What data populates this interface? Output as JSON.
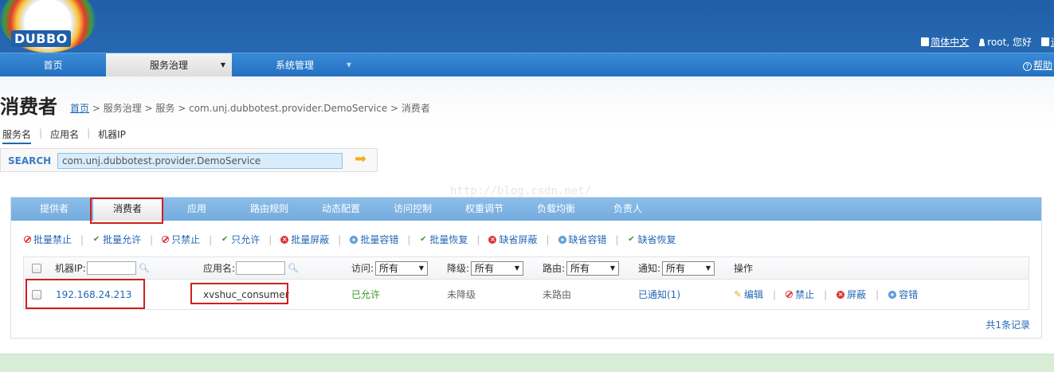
{
  "header": {
    "logo_text": "DUBBO",
    "language_label": "简体中文",
    "user_greeting": "root, 您好",
    "logout_label": "退出"
  },
  "nav": {
    "items": [
      {
        "label": "首页"
      },
      {
        "label": "服务治理"
      },
      {
        "label": "系统管理"
      }
    ],
    "help_label": "帮助"
  },
  "page": {
    "title": "消费者",
    "breadcrumb_home": "首页",
    "breadcrumb_rest": " > 服务治理 > 服务 > com.unj.dubbotest.provider.DemoService > 消费者"
  },
  "search": {
    "tabs": [
      "服务名",
      "应用名",
      "机器IP"
    ],
    "label": "SEARCH",
    "value": "com.unj.dubbotest.provider.DemoService"
  },
  "watermark": "http://blog.csdn.net/",
  "subtabs": [
    "提供者",
    "消费者",
    "应用",
    "路由规则",
    "动态配置",
    "访问控制",
    "权重调节",
    "负载均衡",
    "负责人"
  ],
  "actions": [
    "批量禁止",
    "批量允许",
    "只禁止",
    "只允许",
    "批量屏蔽",
    "批量容错",
    "批量恢复",
    "缺省屏蔽",
    "缺省容错",
    "缺省恢复"
  ],
  "table": {
    "headers": {
      "ip": "机器IP:",
      "app": "应用名:",
      "access": "访问:",
      "degrade": "降级:",
      "route": "路由:",
      "notify": "通知:",
      "ops": "操作"
    },
    "filter_option": "所有",
    "row": {
      "ip": "192.168.24.213",
      "app": "xvshuc_consumer",
      "access": "已允许",
      "degrade": "未降级",
      "route": "未路由",
      "notify": "已通知(1)",
      "ops": [
        "编辑",
        "禁止",
        "屏蔽",
        "容错"
      ]
    },
    "total": "共1条记录"
  },
  "colors": {
    "header_blue": "#2768b2",
    "nav_blue": "#2f7dcd",
    "subtab_blue": "#7fb5e3",
    "link_blue": "#2468b4",
    "allow_green": "#3a9a2a",
    "highlight_red": "#d21e1e",
    "footer_green": "#d8ecd6"
  }
}
